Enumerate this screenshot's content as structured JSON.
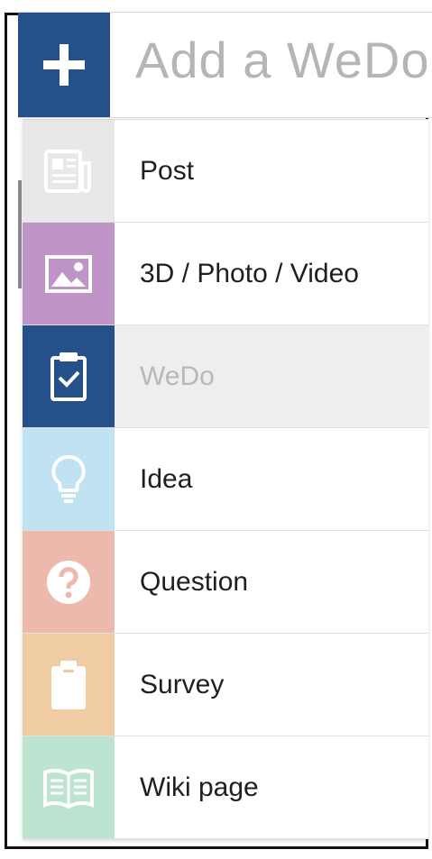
{
  "header": {
    "add_icon": "plus-icon",
    "input_placeholder": "Add a WeDo"
  },
  "menu": {
    "items": [
      {
        "label": "Post",
        "icon": "newspaper-icon",
        "color": "#e8e8e8"
      },
      {
        "label": "3D / Photo / Video",
        "icon": "image-icon",
        "color": "#bf94c7"
      },
      {
        "label": "WeDo",
        "icon": "clipboard-check-icon",
        "color": "#26508a",
        "state": "selected"
      },
      {
        "label": "Idea",
        "icon": "lightbulb-icon",
        "color": "#bfe3f3"
      },
      {
        "label": "Question",
        "icon": "question-circle-icon",
        "color": "#edb9ad"
      },
      {
        "label": "Survey",
        "icon": "clipboard-icon",
        "color": "#f0cca5"
      },
      {
        "label": "Wiki page",
        "icon": "book-icon",
        "color": "#bde3d1"
      }
    ]
  },
  "colors": {
    "brand_blue": "#26508a",
    "placeholder_gray": "#b5b5b5",
    "selected_bg": "#eeeeee"
  }
}
